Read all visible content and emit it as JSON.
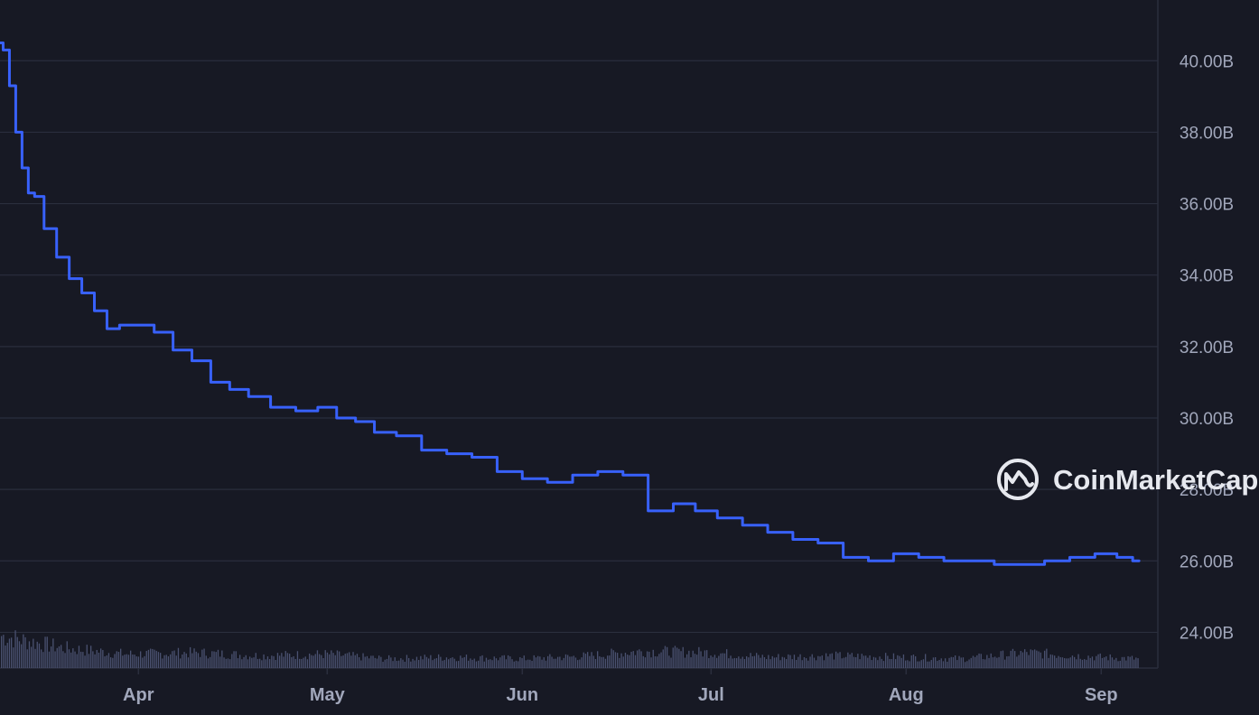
{
  "colors": {
    "background": "#171924",
    "grid": "#2a2e3d",
    "line": "#3861fb",
    "volume": "#4a5170",
    "tick_text": "#a1a7bb",
    "watermark": "#e6e8ee"
  },
  "watermark": {
    "brand": "CoinMarketCap",
    "icon": "coinmarketcap-logo-icon"
  },
  "chart_data": {
    "type": "line",
    "title": "",
    "xlabel": "",
    "ylabel": "",
    "y_axis_position": "right",
    "ylim": [
      23.0,
      41.7
    ],
    "yticks": [
      24,
      26,
      28,
      30,
      32,
      34,
      36,
      38,
      40
    ],
    "ytick_labels": [
      "24.00B",
      "26.00B",
      "28.00B",
      "30.00B",
      "32.00B",
      "34.00B",
      "36.00B",
      "38.00B",
      "40.00B"
    ],
    "xlim": [
      "2024-03-10",
      "2024-09-10"
    ],
    "xticks": [
      "2024-04-01",
      "2024-05-01",
      "2024-06-01",
      "2024-07-01",
      "2024-08-01",
      "2024-09-01"
    ],
    "xtick_labels": [
      "Apr",
      "May",
      "Jun",
      "Jul",
      "Aug",
      "Sep"
    ],
    "grid": true,
    "legend": "none",
    "series": [
      {
        "x": [
          "2024-03-10",
          "2024-03-11",
          "2024-03-12",
          "2024-03-13",
          "2024-03-14",
          "2024-03-15",
          "2024-03-16",
          "2024-03-18",
          "2024-03-20",
          "2024-03-22",
          "2024-03-24",
          "2024-03-26",
          "2024-03-28",
          "2024-03-30",
          "2024-04-02",
          "2024-04-05",
          "2024-04-08",
          "2024-04-11",
          "2024-04-14",
          "2024-04-17",
          "2024-04-20",
          "2024-04-24",
          "2024-04-28",
          "2024-05-01",
          "2024-05-04",
          "2024-05-07",
          "2024-05-10",
          "2024-05-14",
          "2024-05-18",
          "2024-05-22",
          "2024-05-26",
          "2024-05-30",
          "2024-06-03",
          "2024-06-07",
          "2024-06-11",
          "2024-06-15",
          "2024-06-19",
          "2024-06-23",
          "2024-06-27",
          "2024-06-30",
          "2024-07-04",
          "2024-07-08",
          "2024-07-12",
          "2024-07-16",
          "2024-07-20",
          "2024-07-24",
          "2024-07-28",
          "2024-08-01",
          "2024-08-05",
          "2024-08-09",
          "2024-08-13",
          "2024-08-17",
          "2024-08-21",
          "2024-08-25",
          "2024-08-29",
          "2024-09-02",
          "2024-09-05",
          "2024-09-07"
        ],
        "y": [
          40.5,
          40.3,
          39.3,
          38.0,
          37.0,
          36.3,
          36.2,
          35.3,
          34.5,
          33.9,
          33.5,
          33.0,
          32.5,
          32.6,
          32.6,
          32.4,
          31.9,
          31.6,
          31.0,
          30.8,
          30.6,
          30.3,
          30.2,
          30.3,
          30.0,
          29.9,
          29.6,
          29.5,
          29.1,
          29.0,
          28.9,
          28.5,
          28.3,
          28.2,
          28.4,
          28.5,
          28.4,
          27.4,
          27.6,
          27.4,
          27.2,
          27.0,
          26.8,
          26.6,
          26.5,
          26.1,
          26.0,
          26.2,
          26.1,
          26.0,
          26.0,
          25.9,
          25.9,
          26.0,
          26.1,
          26.2,
          26.1,
          26.0
        ]
      }
    ],
    "volume": {
      "x": [
        "2024-03-10",
        "2024-03-20",
        "2024-03-30",
        "2024-04-10",
        "2024-04-20",
        "2024-05-01",
        "2024-05-10",
        "2024-05-20",
        "2024-06-01",
        "2024-06-10",
        "2024-06-20",
        "2024-07-01",
        "2024-07-10",
        "2024-07-20",
        "2024-08-01",
        "2024-08-10",
        "2024-08-20",
        "2024-09-01",
        "2024-09-07"
      ],
      "values": [
        0.42,
        0.26,
        0.18,
        0.2,
        0.16,
        0.18,
        0.12,
        0.14,
        0.12,
        0.15,
        0.22,
        0.2,
        0.14,
        0.16,
        0.14,
        0.12,
        0.2,
        0.14,
        0.12
      ]
    }
  }
}
